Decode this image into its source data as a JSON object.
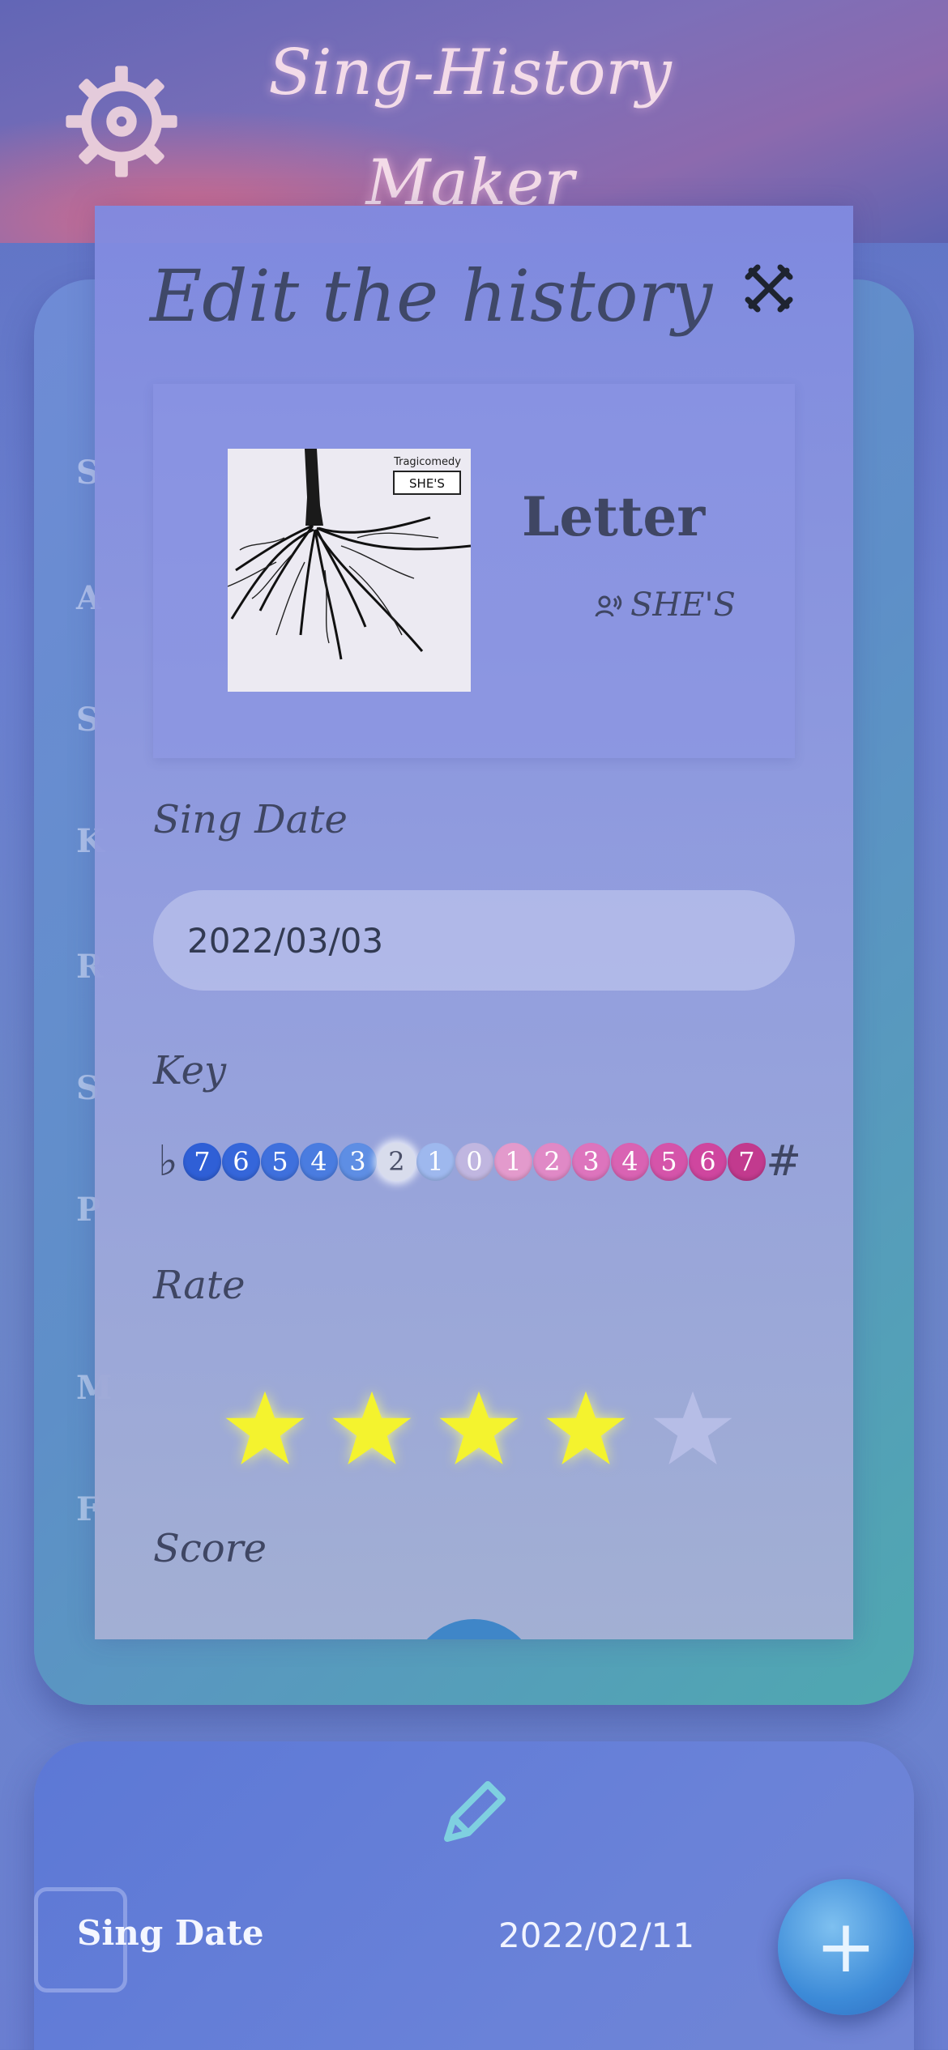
{
  "app": {
    "title": "Sing-History Maker"
  },
  "background": {
    "card": {
      "sing_date_label": "Sing Date",
      "sing_date_value": "2022/02/11"
    },
    "fab_label": "+"
  },
  "modal": {
    "title": "Edit the history",
    "close_icon": "close-crossed-swords-icon",
    "song": {
      "title": "Letter",
      "artist": "SHE'S",
      "jacket_subtitle": "Tragicomedy",
      "jacket_badge": "SHE'S"
    },
    "sing_date": {
      "label": "Sing Date",
      "value": "2022/03/03"
    },
    "key": {
      "label": "Key",
      "flat": "♭",
      "sharp": "#",
      "selected": "-2",
      "options": [
        {
          "v": "7",
          "color": "#2f5fd6"
        },
        {
          "v": "6",
          "color": "#3566da"
        },
        {
          "v": "5",
          "color": "#3f70dd"
        },
        {
          "v": "4",
          "color": "#4a7ce0"
        },
        {
          "v": "3",
          "color": "#5e8ee4"
        },
        {
          "v": "2",
          "color": "#d8dcec"
        },
        {
          "v": "1",
          "color": "#9eb8ee"
        },
        {
          "v": "0",
          "color": "#c0b6e0"
        },
        {
          "v": "1",
          "color": "#e39acc"
        },
        {
          "v": "2",
          "color": "#e089c6"
        },
        {
          "v": "3",
          "color": "#dd74bd"
        },
        {
          "v": "4",
          "color": "#d963b3"
        },
        {
          "v": "5",
          "color": "#d554aa"
        },
        {
          "v": "6",
          "color": "#cf469f"
        },
        {
          "v": "7",
          "color": "#c23a8e"
        }
      ]
    },
    "rate": {
      "label": "Rate",
      "value": 4,
      "max": 5,
      "filled_color": "#f4f32e",
      "empty_color": "#b6bde6"
    },
    "score": {
      "label": "Score"
    }
  }
}
